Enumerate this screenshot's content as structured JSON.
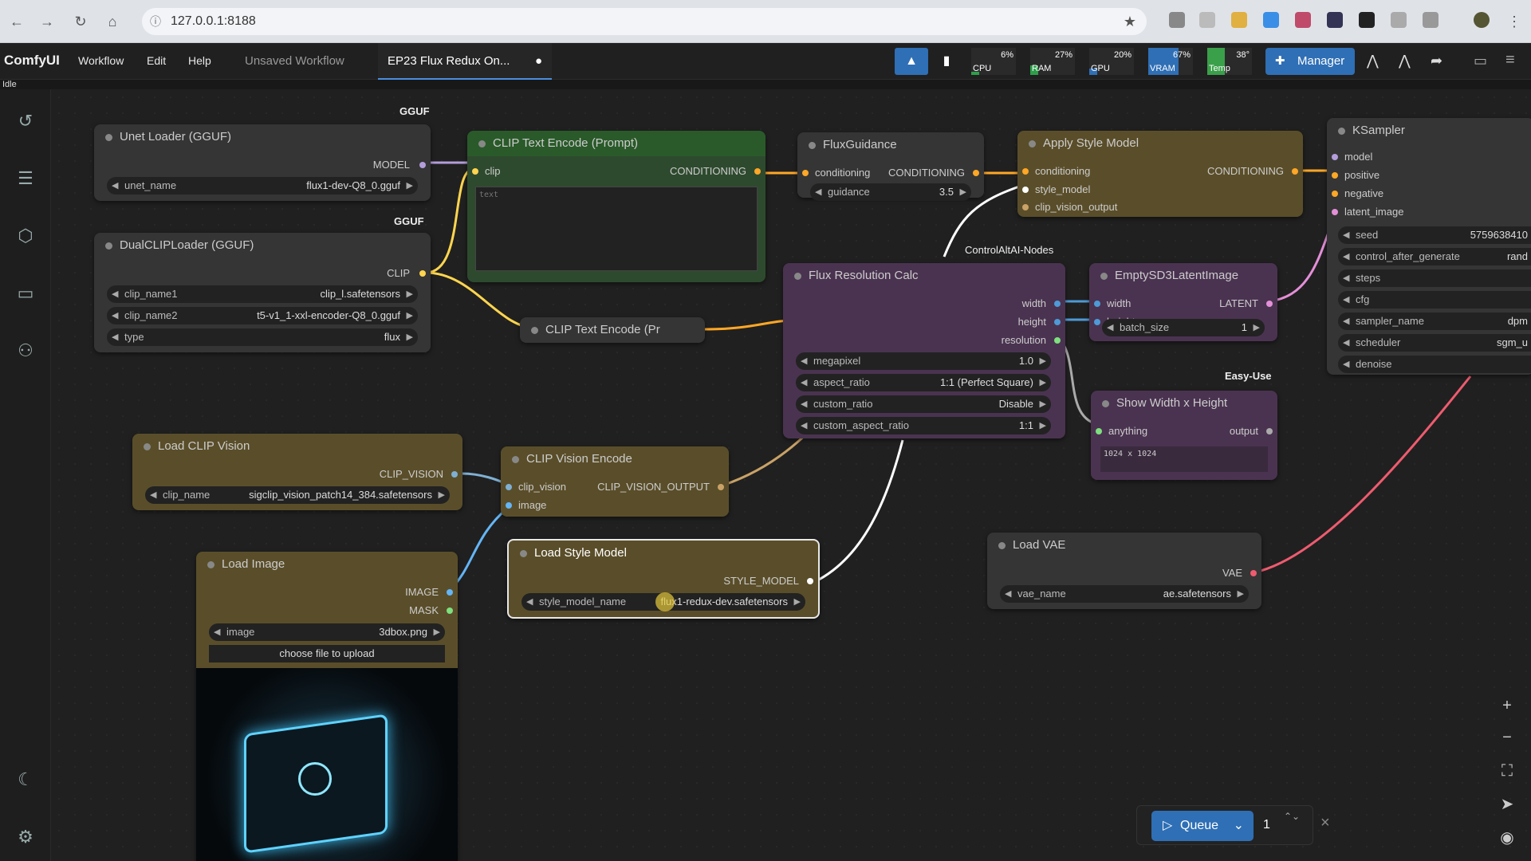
{
  "browser": {
    "url": "127.0.0.1:8188"
  },
  "menubar": {
    "brand": "ComfyUI",
    "menus": [
      "Workflow",
      "Edit",
      "Help"
    ],
    "tabs": [
      "Unsaved Workflow",
      "EP23 Flux Redux On...",
      "●"
    ],
    "monitors": [
      {
        "label": "CPU",
        "pct": "6%",
        "color": "#2e9e4a"
      },
      {
        "label": "RAM",
        "pct": "27%",
        "color": "#2e9e4a"
      },
      {
        "label": "GPU",
        "pct": "20%",
        "color": "#2f6fb5"
      },
      {
        "label": "VRAM",
        "pct": "67%",
        "color": "#2f6fb5"
      },
      {
        "label": "Temp",
        "pct": "38°",
        "color": "#3aa04a"
      }
    ],
    "manager": "Manager",
    "status": "Idle"
  },
  "tags": {
    "gguf1": "GGUF",
    "gguf2": "GGUF",
    "controlaltai": "ControlAltAI-Nodes",
    "easyuse": "Easy-Use"
  },
  "nodes": {
    "unet": {
      "title": "Unet Loader (GGUF)",
      "out": "MODEL",
      "w_label": "unet_name",
      "w_value": "flux1-dev-Q8_0.gguf"
    },
    "dualclip": {
      "title": "DualCLIPLoader (GGUF)",
      "out": "CLIP",
      "w1l": "clip_name1",
      "w1v": "clip_l.safetensors",
      "w2l": "clip_name2",
      "w2v": "t5-v1_1-xxl-encoder-Q8_0.gguf",
      "w3l": "type",
      "w3v": "flux"
    },
    "cliptext": {
      "title": "CLIP Text Encode (Prompt)",
      "in": "clip",
      "out": "CONDITIONING",
      "placeholder": "text"
    },
    "cliptext2": {
      "title": "CLIP Text Encode (Pr"
    },
    "fluxguid": {
      "title": "FluxGuidance",
      "in": "conditioning",
      "out": "CONDITIONING",
      "wl": "guidance",
      "wv": "3.5"
    },
    "applystyle": {
      "title": "Apply Style Model",
      "in1": "conditioning",
      "in2": "style_model",
      "in3": "clip_vision_output",
      "out": "CONDITIONING"
    },
    "ksampler": {
      "title": "KSampler",
      "in": [
        "model",
        "positive",
        "negative",
        "latent_image"
      ],
      "widgets": [
        [
          "seed",
          "5759638410"
        ],
        [
          "control_after_generate",
          "rand"
        ],
        [
          "steps",
          ""
        ],
        [
          "cfg",
          ""
        ],
        [
          "sampler_name",
          "dpm"
        ],
        [
          "scheduler",
          "sgm_u"
        ],
        [
          "denoise",
          ""
        ]
      ]
    },
    "fluxres": {
      "title": "Flux Resolution Calc",
      "o1": "width",
      "o2": "height",
      "o3": "resolution",
      "w1l": "megapixel",
      "w1v": "1.0",
      "w2l": "aspect_ratio",
      "w2v": "1:1 (Perfect Square)",
      "w3l": "custom_ratio",
      "w3v": "Disable",
      "w4l": "custom_aspect_ratio",
      "w4v": "1:1"
    },
    "emptylatent": {
      "title": "EmptySD3LatentImage",
      "i1": "width",
      "i2": "height",
      "out": "LATENT",
      "wl": "batch_size",
      "wv": "1"
    },
    "showwh": {
      "title": "Show Width x Height",
      "in": "anything",
      "out": "output",
      "text": "1024 x 1024"
    },
    "loadclipv": {
      "title": "Load CLIP Vision",
      "out": "CLIP_VISION",
      "wl": "clip_name",
      "wv": "sigclip_vision_patch14_384.safetensors"
    },
    "clipvenc": {
      "title": "CLIP Vision Encode",
      "i1": "clip_vision",
      "i2": "image",
      "out": "CLIP_VISION_OUTPUT"
    },
    "loadstyle": {
      "title": "Load Style Model",
      "out": "STYLE_MODEL",
      "wl": "style_model_name",
      "wv": "flux1-redux-dev.safetensors"
    },
    "loadvae": {
      "title": "Load VAE",
      "out": "VAE",
      "wl": "vae_name",
      "wv": "ae.safetensors"
    },
    "loadimage": {
      "title": "Load Image",
      "o1": "IMAGE",
      "o2": "MASK",
      "wl": "image",
      "wv": "3dbox.png",
      "upload": "choose file to upload"
    }
  },
  "queue": {
    "label": "Queue",
    "count": "1"
  }
}
